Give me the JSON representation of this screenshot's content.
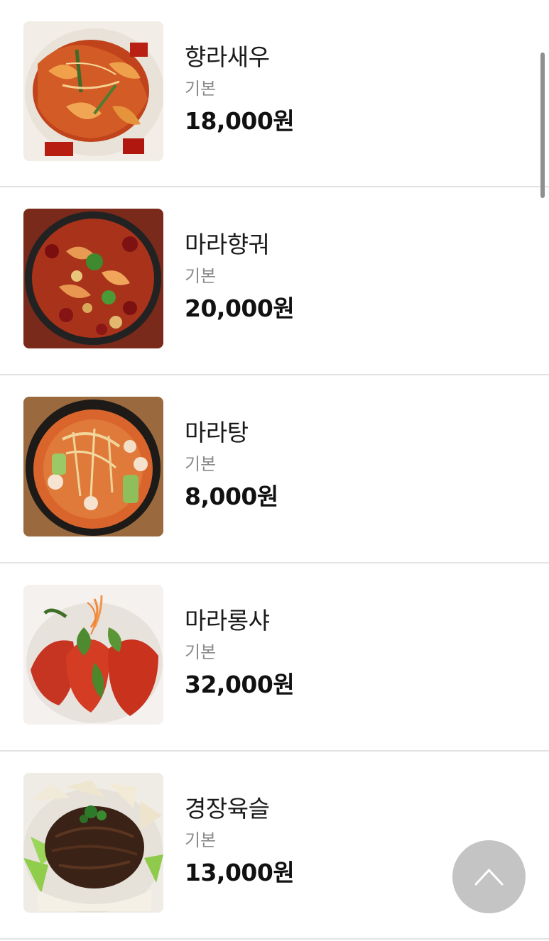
{
  "menu": {
    "items": [
      {
        "name": "향라새우",
        "option": "기본",
        "price": "18,000원",
        "image_icon": "shrimp-dish-photo"
      },
      {
        "name": "마라향궈",
        "option": "기본",
        "price": "20,000원",
        "image_icon": "mala-xiangguo-photo"
      },
      {
        "name": "마라탕",
        "option": "기본",
        "price": "8,000원",
        "image_icon": "malatang-soup-photo"
      },
      {
        "name": "마라롱샤",
        "option": "기본",
        "price": "32,000원",
        "image_icon": "crayfish-photo"
      },
      {
        "name": "경장육슬",
        "option": "기본",
        "price": "13,000원",
        "image_icon": "jingjiang-rousi-photo"
      }
    ]
  },
  "controls": {
    "scroll_top_icon": "chevron-up-icon"
  },
  "colors": {
    "divider": "#e3e3e3",
    "option_text": "#8a8a8a",
    "scroll_top_button": "#c4c4c4",
    "scrollbar": "#8f8f8f"
  }
}
